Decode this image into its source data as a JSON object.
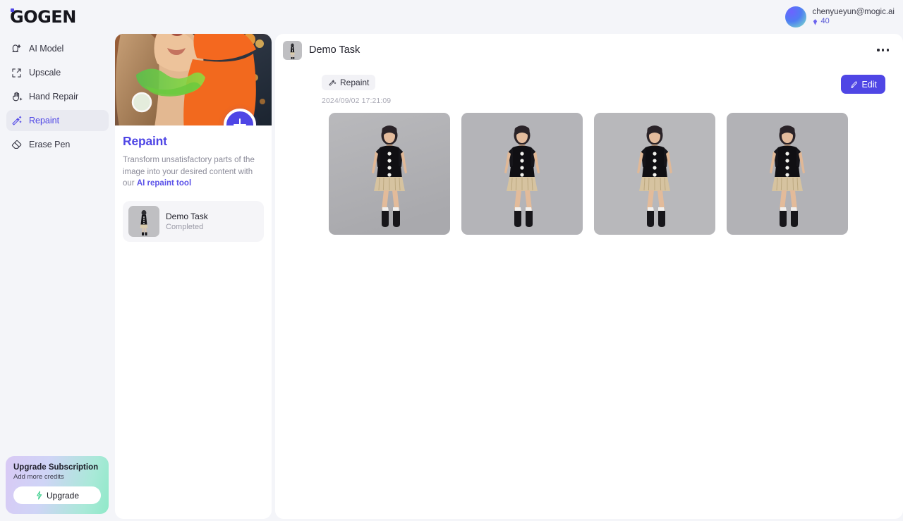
{
  "brand": {
    "name": "GOGEN"
  },
  "account": {
    "email": "chenyueyun@mogic.ai",
    "credits": "40",
    "gem_icon": "gem-icon",
    "avatar_icon": "avatar"
  },
  "sidebar": {
    "items": [
      {
        "label": "AI Model",
        "icon": "ai-model-icon",
        "active": false
      },
      {
        "label": "Upscale",
        "icon": "upscale-icon",
        "active": false
      },
      {
        "label": "Hand Repair",
        "icon": "hand-repair-icon",
        "active": false
      },
      {
        "label": "Repaint",
        "icon": "magic-wand-icon",
        "active": true
      },
      {
        "label": "Erase Pen",
        "icon": "eraser-icon",
        "active": false
      }
    ],
    "upgrade": {
      "title": "Upgrade Subscription",
      "subtitle": "Add more credits",
      "button_label": "Upgrade",
      "button_icon": "lightning-bolt-icon"
    }
  },
  "tool_panel": {
    "add_button_icon": "plus-icon",
    "title": "Repaint",
    "description_before": "Transform unsatisfactory parts of the image into your desired content with our ",
    "description_link": "AI repaint tool",
    "task": {
      "name": "Demo Task",
      "status": "Completed",
      "thumbnail_icon": "model-thumbnail"
    }
  },
  "collapse_handle": {
    "icon": "chevron-right-icon"
  },
  "main": {
    "title": "Demo Task",
    "thumbnail_icon": "model-thumbnail",
    "more_menu_icon": "more-horizontal-icon",
    "badge": {
      "label": "Repaint",
      "icon": "magic-wand-icon"
    },
    "timestamp": "2024/09/02 17:21:09",
    "edit_button": {
      "label": "Edit",
      "icon": "brush-icon"
    },
    "gallery": [
      {
        "alt": "Model in black button vest and beige pleated skirt"
      },
      {
        "alt": "Model in black button vest and beige pleated skirt"
      },
      {
        "alt": "Model in black button vest and beige pleated skirt"
      },
      {
        "alt": "Model in black button vest and beige pleated skirt"
      }
    ]
  },
  "colors": {
    "accent": "#4f46e5",
    "page_bg": "#f4f5f9",
    "panel_bg": "#ffffff",
    "active_nav_bg": "#e9eaf1",
    "muted_text": "#8b8b99"
  }
}
